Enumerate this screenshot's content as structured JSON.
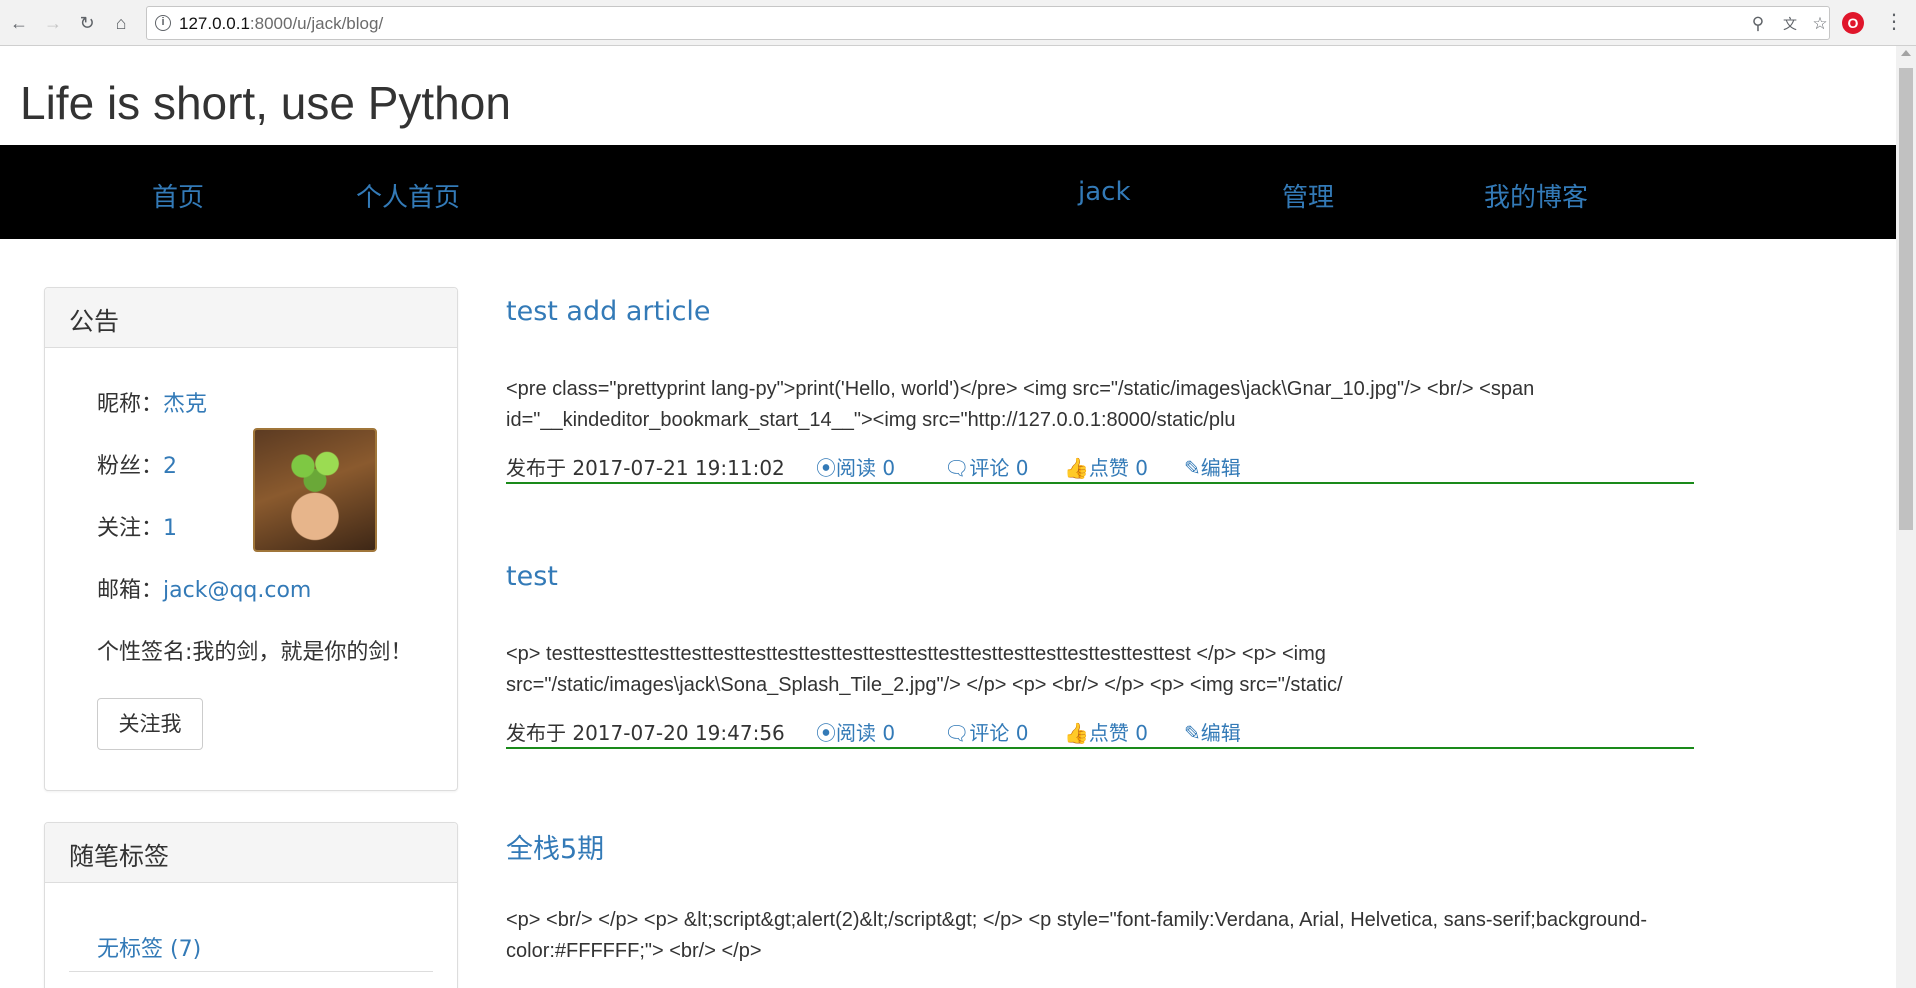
{
  "browser": {
    "url_host": "127.0.0.1",
    "url_path": ":8000/u/jack/blog/",
    "icons": [
      "back-icon",
      "forward-icon",
      "reload-icon",
      "home-icon",
      "zoom-icon",
      "translate-icon",
      "star-icon",
      "opera-icon",
      "menu-icon"
    ]
  },
  "site": {
    "title": "Life is short, use Python"
  },
  "nav": {
    "home": "首页",
    "profile": "个人首页",
    "user": "jack",
    "manage": "管理",
    "my_blog": "我的博客"
  },
  "notice": {
    "heading": "公告",
    "nickname_label": "昵称：",
    "nickname": "杰克",
    "fans_label": "粉丝：",
    "fans": "2",
    "follow_label": "关注：",
    "follow": "1",
    "email_label": "邮箱：",
    "email": "jack@qq.com",
    "signature": "个性签名:我的剑，就是你的剑！",
    "follow_button": "关注我"
  },
  "tags": {
    "heading": "随笔标签",
    "items": [
      {
        "label": "无标签 (7)"
      }
    ]
  },
  "articles": [
    {
      "title": "test add article",
      "summary": "<pre class=\"prettyprint lang-py\">print('Hello, world')</pre> <img src=\"/static/images\\jack\\Gnar_10.jpg\"/> <br/> <span id=\"__kindeditor_bookmark_start_14__\"><img src=\"http://127.0.0.1:8000/static/plu",
      "published": "发布于 2017-07-21 19:11:02",
      "read": "阅读 0",
      "comment": "评论 0",
      "like": "点赞 0",
      "edit": "编辑"
    },
    {
      "title": "test",
      "summary": "<p> testtesttesttesttesttesttesttesttesttesttesttesttesttesttesttesttesttesttesttest </p> <p> <img src=\"/static/images\\jack\\Sona_Splash_Tile_2.jpg\"/> </p> <p> <br/> </p> <p> <img src=\"/static/",
      "published": "发布于 2017-07-20 19:47:56",
      "read": "阅读 0",
      "comment": "评论 0",
      "like": "点赞 0",
      "edit": "编辑"
    },
    {
      "title": "全栈5期",
      "summary": "<p> <br/> </p> <p> &lt;script&gt;alert(2)&lt;/script&gt; </p> <p style=\"font-family:Verdana, Arial, Helvetica, sans-serif;background-color:#FFFFFF;\"> <br/> </p>"
    }
  ],
  "colors": {
    "link": "#337ab7",
    "navbar": "#000000",
    "footer_rule": "#1a8a1a"
  }
}
